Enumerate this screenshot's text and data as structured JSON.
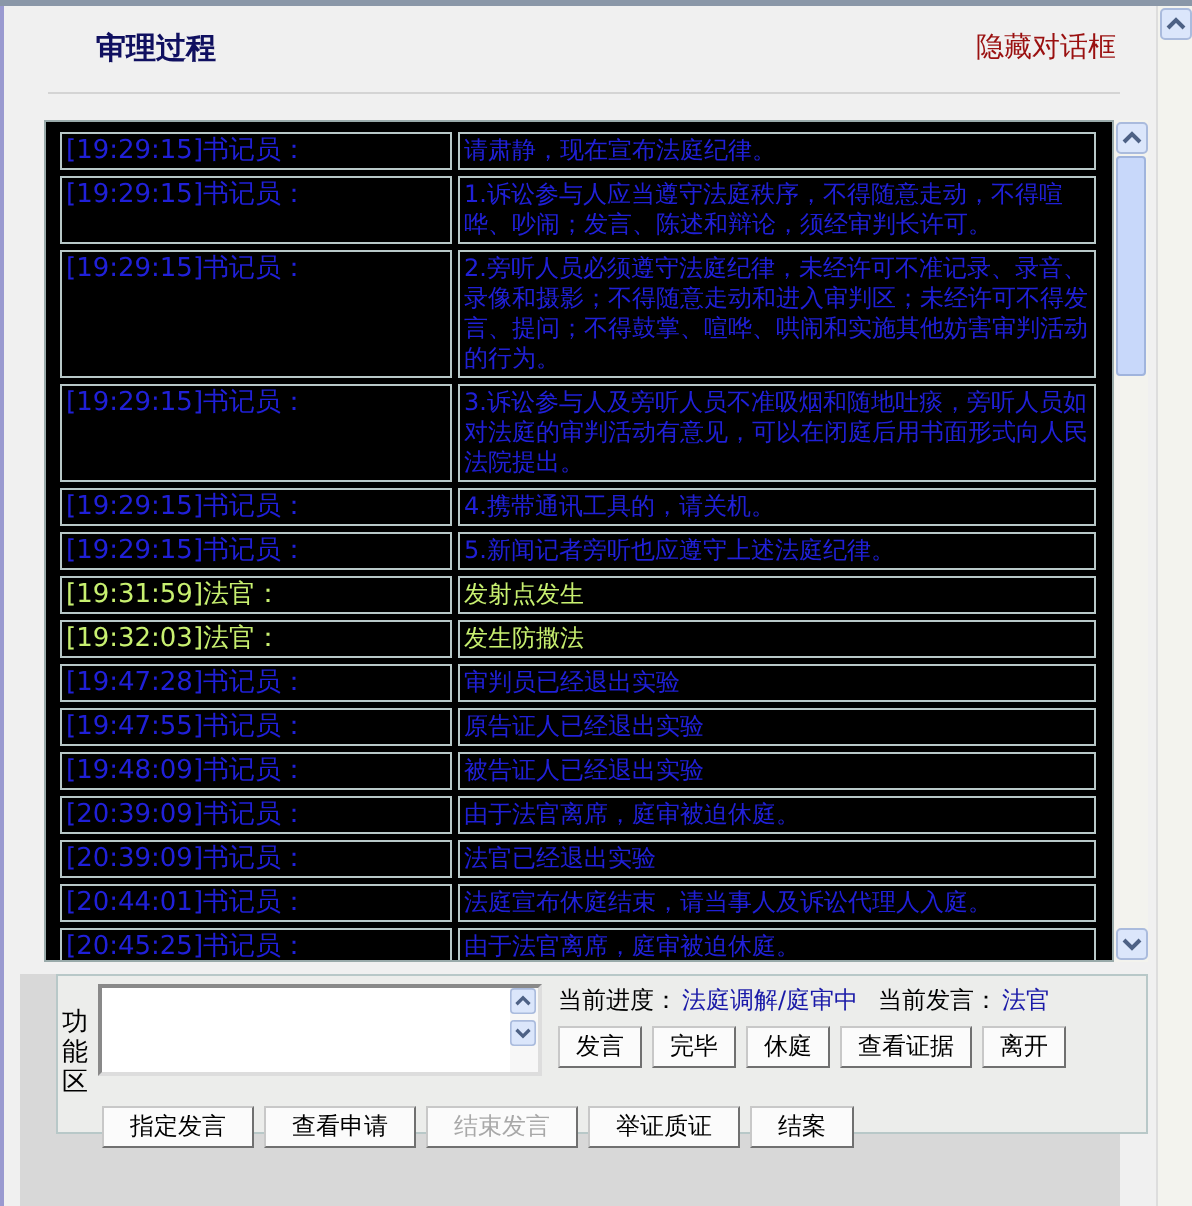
{
  "header": {
    "title": "审理过程",
    "hide_link": "隐藏对话框"
  },
  "log": [
    {
      "kind": "clerk",
      "time": "[19:29:15]书记员：",
      "text": "请肃静，现在宣布法庭纪律。"
    },
    {
      "kind": "clerk",
      "time": "[19:29:15]书记员：",
      "text": "1.诉讼参与人应当遵守法庭秩序，不得随意走动，不得喧哗、吵闹；发言、陈述和辩论，须经审判长许可。"
    },
    {
      "kind": "clerk",
      "time": "[19:29:15]书记员：",
      "text": "2.旁听人员必须遵守法庭纪律，未经许可不准记录、录音、录像和摄影；不得随意走动和进入审判区；未经许可不得发言、提问；不得鼓掌、喧哗、哄闹和实施其他妨害审判活动的行为。"
    },
    {
      "kind": "clerk",
      "time": "[19:29:15]书记员：",
      "text": "3.诉讼参与人及旁听人员不准吸烟和随地吐痰，旁听人员如对法庭的审判活动有意见，可以在闭庭后用书面形式向人民法院提出。"
    },
    {
      "kind": "clerk",
      "time": "[19:29:15]书记员：",
      "text": "4.携带通讯工具的，请关机。"
    },
    {
      "kind": "clerk",
      "time": "[19:29:15]书记员：",
      "text": "5.新闻记者旁听也应遵守上述法庭纪律。"
    },
    {
      "kind": "judge",
      "time": "[19:31:59]法官：",
      "text": "发射点发生"
    },
    {
      "kind": "judge",
      "time": "[19:32:03]法官：",
      "text": "发生防撒法"
    },
    {
      "kind": "clerk",
      "time": "[19:47:28]书记员：",
      "text": "审判员已经退出实验"
    },
    {
      "kind": "clerk",
      "time": "[19:47:55]书记员：",
      "text": "原告证人已经退出实验"
    },
    {
      "kind": "clerk",
      "time": "[19:48:09]书记员：",
      "text": "被告证人已经退出实验"
    },
    {
      "kind": "clerk",
      "time": "[20:39:09]书记员：",
      "text": "由于法官离席，庭审被迫休庭。"
    },
    {
      "kind": "clerk",
      "time": "[20:39:09]书记员：",
      "text": "法官已经退出实验"
    },
    {
      "kind": "clerk",
      "time": "[20:44:01]书记员：",
      "text": "法庭宣布休庭结束，请当事人及诉讼代理人入庭。"
    },
    {
      "kind": "clerk",
      "time": "[20:45:25]书记员：",
      "text": "由于法官离席，庭审被迫休庭。"
    }
  ],
  "panel": {
    "label": "功能区",
    "progress_label": "当前进度：",
    "progress": "法庭调解/庭审中",
    "speaker_label": "当前发言：",
    "speaker": "法官",
    "buttons_row1": [
      {
        "label": "发言",
        "disabled": false
      },
      {
        "label": "完毕",
        "disabled": false
      },
      {
        "label": "休庭",
        "disabled": false
      },
      {
        "label": "查看证据",
        "disabled": false
      },
      {
        "label": "离开",
        "disabled": false
      }
    ],
    "buttons_row2": [
      {
        "label": "指定发言",
        "disabled": false
      },
      {
        "label": "查看申请",
        "disabled": false
      },
      {
        "label": "结束发言",
        "disabled": true
      },
      {
        "label": "举证质证",
        "disabled": false
      },
      {
        "label": "结案",
        "disabled": false
      }
    ]
  }
}
